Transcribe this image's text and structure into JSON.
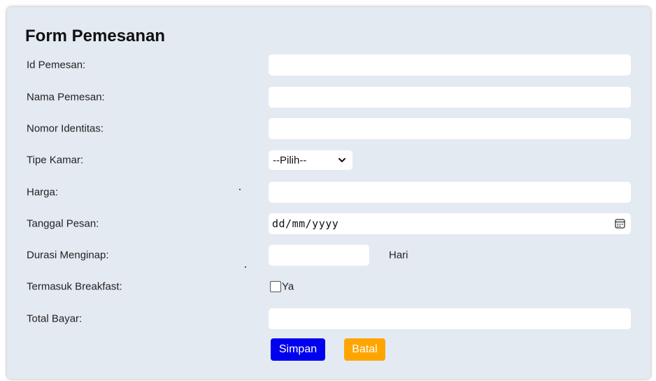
{
  "form": {
    "title": "Form Pemesanan",
    "fields": {
      "id_pemesan": {
        "label": "Id Pemesan:",
        "value": ""
      },
      "nama_pemesan": {
        "label": "Nama Pemesan:",
        "value": ""
      },
      "nomor_identitas": {
        "label": "Nomor Identitas:",
        "value": ""
      },
      "tipe_kamar": {
        "label": "Tipe Kamar:",
        "selected": "--Pilih--"
      },
      "harga": {
        "label": "Harga:",
        "value": ""
      },
      "tanggal_pesan": {
        "label": "Tanggal Pesan:",
        "placeholder": "dd/mm/yyyy"
      },
      "durasi_menginap": {
        "label": "Durasi Menginap:",
        "value": "",
        "suffix": "Hari"
      },
      "termasuk_breakfast": {
        "label": "Termasuk Breakfast:",
        "option_label": "Ya",
        "checked": false
      },
      "total_bayar": {
        "label": "Total Bayar:",
        "value": ""
      }
    },
    "buttons": {
      "save_label": "Simpan",
      "cancel_label": "Batal"
    }
  },
  "colors": {
    "card_background": "#e4eaf2",
    "save_button": "#0000ee",
    "cancel_button": "#ffa500"
  },
  "icons": {
    "select_arrow": "chevron-down-icon",
    "date_picker": "calendar-icon"
  }
}
